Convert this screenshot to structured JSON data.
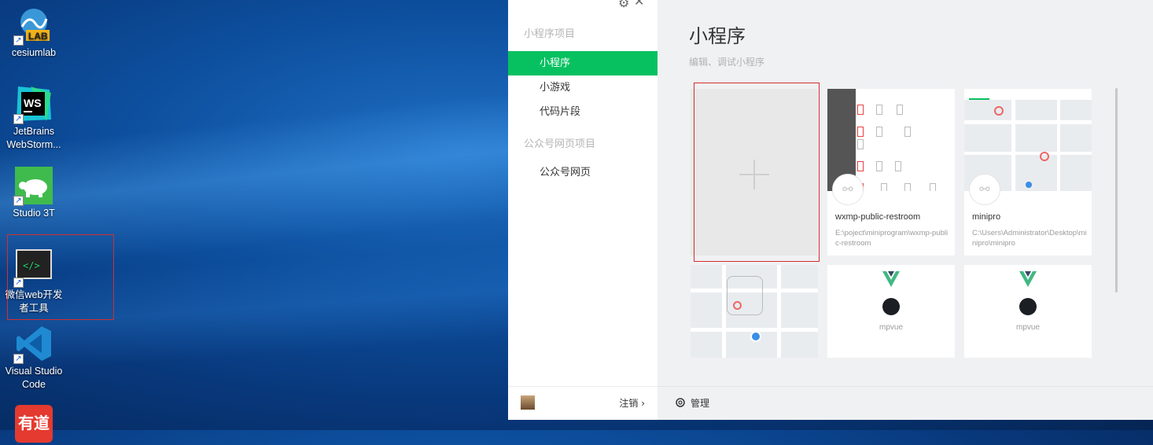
{
  "desktop": {
    "icons": [
      {
        "label": "cesiumlab"
      },
      {
        "label": "JetBrains WebStorm..."
      },
      {
        "label": "Studio 3T"
      },
      {
        "label": "微信web开发者工具"
      },
      {
        "label": "Visual Studio Code"
      },
      {
        "label": "有道"
      }
    ]
  },
  "sidebar": {
    "section1_title": "小程序项目",
    "items1": [
      {
        "label": "小程序",
        "active": true
      },
      {
        "label": "小游戏",
        "active": false
      },
      {
        "label": "代码片段",
        "active": false
      }
    ],
    "section2_title": "公众号网页项目",
    "items2": [
      {
        "label": "公众号网页",
        "active": false
      }
    ],
    "logout_label": "注销 ›"
  },
  "main": {
    "title": "小程序",
    "subtitle": "编辑、调试小程序",
    "projects": [
      {
        "name": "wxmp-public-restroom",
        "path": "E:\\poject\\miniprogram\\wxmp-public-restroom"
      },
      {
        "name": "minipro",
        "path": "C:\\Users\\Administrator\\Desktop\\minipro\\minipro"
      }
    ],
    "mpvue_label": "mpvue",
    "manage_label": "管理"
  },
  "colors": {
    "accent": "#07c160",
    "highlight_outline": "#d32f2f"
  }
}
